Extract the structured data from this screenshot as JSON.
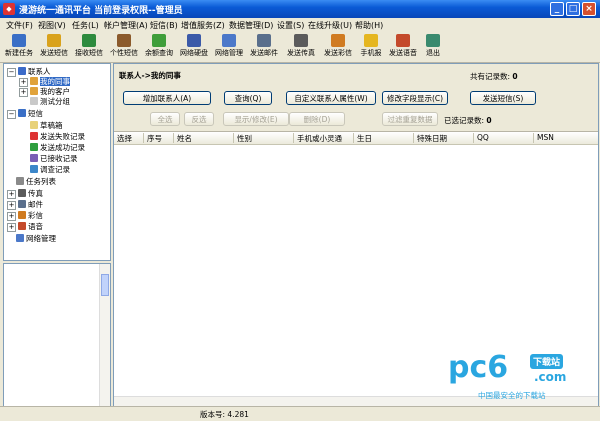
{
  "window": {
    "title": "漫游统一通讯平台  当前登录权限--管理员",
    "app_icon": "sms-app-icon",
    "min": "_",
    "max": "□",
    "close": "×"
  },
  "menu": [
    "文件(F)",
    "视图(V)",
    "任务(L)",
    "帐户管理(A)",
    "短信(B)",
    "增值服务(Z)",
    "数据管理(D)",
    "设置(S)",
    "在线升级(U)",
    "帮助(H)"
  ],
  "toolbar": [
    {
      "label": "新建任务",
      "icon": "envelope-icon",
      "color": "#3a6fc6"
    },
    {
      "label": "发送短信",
      "icon": "phone-send-icon",
      "color": "#d9a21c"
    },
    {
      "label": "接收短信",
      "icon": "phone-receive-icon",
      "color": "#2e8b3e"
    },
    {
      "label": "个性短信",
      "icon": "pen-icon",
      "color": "#8b5a2b"
    },
    {
      "label": "余额查询",
      "icon": "coins-icon",
      "color": "#3f9e3a"
    },
    {
      "label": "网络硬盘",
      "icon": "disk-icon",
      "color": "#3b5aa8"
    },
    {
      "label": "网络管理",
      "icon": "network-icon",
      "color": "#4b78c9"
    },
    {
      "label": "发送邮件",
      "icon": "mail-icon",
      "color": "#5a6f8c"
    },
    {
      "label": "发送传真",
      "icon": "fax-icon",
      "color": "#5b5b5b"
    },
    {
      "label": "发送彩信",
      "icon": "mms-icon",
      "color": "#d07b21"
    },
    {
      "label": "手机报",
      "icon": "star-icon",
      "color": "#e5b620"
    },
    {
      "label": "发送语音",
      "icon": "voice-icon",
      "color": "#c44a2b"
    },
    {
      "label": "退出",
      "icon": "exit-icon",
      "color": "#3a8a6e"
    }
  ],
  "tree": {
    "contacts": "联系人",
    "my_colleagues": "我的同事",
    "my_customers": "我的客户",
    "test_group": "测试分组",
    "sms": "短信",
    "drafts": "草稿箱",
    "failed": "发送失败记录",
    "success": "发送成功记录",
    "received": "已接收记录",
    "survey": "调查记录",
    "tasks": "任务列表",
    "fax": "传真",
    "mail": "邮件",
    "mms": "彩信",
    "voice": "语音",
    "netmgmt": "网络管理"
  },
  "main": {
    "breadcrumb": "联系人->我的同事",
    "total_label": "共有记录数:",
    "total_value": "0",
    "selected_label": "已选记录数:",
    "selected_value": "0",
    "buttons": {
      "add": "增加联系人(A)",
      "query": "查询(Q)",
      "custom_attr": "自定义联系人属性(W)",
      "edit_fields": "修改字段显示(C)",
      "send_sms": "发送短信(S)",
      "select_all": "全选",
      "invert": "反选",
      "show_edit": "显示/修改(E)",
      "delete": "删除(D)",
      "filter_dup": "过滤重复数据"
    },
    "columns": [
      "选择",
      "序号",
      "姓名",
      "性别",
      "手机或小灵通",
      "生日",
      "特殊日期",
      "QQ",
      "MSN"
    ]
  },
  "status": {
    "version": "版本号: 4.281"
  },
  "watermark": {
    "logo": "pc6",
    "download": "下载站",
    "com": ".com",
    "slogan": "中国最安全的下载站"
  }
}
